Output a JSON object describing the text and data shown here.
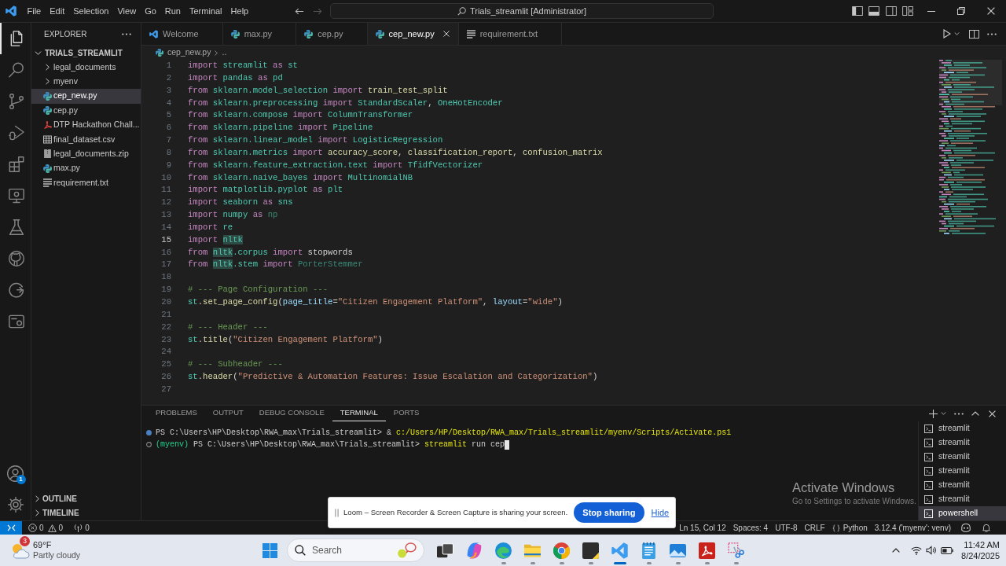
{
  "title_bar": {
    "menu": [
      "File",
      "Edit",
      "Selection",
      "View",
      "Go",
      "Run",
      "Terminal",
      "Help"
    ],
    "navigation": [
      {
        "disabled": false
      },
      {
        "disabled": true
      }
    ],
    "command_center": "Trials_streamlit [Administrator]"
  },
  "activity_bar": {
    "items": [
      {
        "selected": true
      },
      {
        "selected": false
      },
      {
        "selected": false
      },
      {
        "selected": false
      },
      {
        "selected": false
      },
      {
        "selected": false
      },
      {
        "selected": false
      },
      {
        "selected": false
      },
      {
        "selected": false
      },
      {
        "selected": false
      }
    ],
    "accounts_badge": "1"
  },
  "explorer": {
    "title": "EXPLORER",
    "tree": [
      {
        "label": "TRIALS_STREAMLIT",
        "kind": "root",
        "expanded": true,
        "selected": false,
        "children": [
          {
            "label": "legal_documents",
            "kind": "folder",
            "expanded": false,
            "selected": false
          },
          {
            "label": "myenv",
            "kind": "folder",
            "expanded": false,
            "selected": false
          },
          {
            "label": "cep_new.py",
            "kind": "python",
            "selected": true
          },
          {
            "label": "cep.py",
            "kind": "python",
            "selected": false
          },
          {
            "label": "DTP Hackathon Chall...",
            "kind": "pdf",
            "selected": false
          },
          {
            "label": "final_dataset.csv",
            "kind": "csv",
            "selected": false
          },
          {
            "label": "legal_documents.zip",
            "kind": "zip",
            "selected": false
          },
          {
            "label": "max.py",
            "kind": "python",
            "selected": false
          },
          {
            "label": "requirement.txt",
            "kind": "text",
            "selected": false
          }
        ]
      }
    ],
    "sections": [
      {
        "label": "OUTLINE",
        "expanded": false
      },
      {
        "label": "TIMELINE",
        "expanded": false
      }
    ]
  },
  "editor": {
    "tabs": [
      {
        "label": "Welcome",
        "kind": "welcome",
        "selected": false
      },
      {
        "label": "max.py",
        "kind": "python",
        "selected": false
      },
      {
        "label": "cep.py",
        "kind": "python",
        "selected": false
      },
      {
        "label": "cep_new.py",
        "kind": "python",
        "selected": true
      },
      {
        "label": "requirement.txt",
        "kind": "text",
        "selected": false
      }
    ],
    "breadcrumb": [
      "cep_new.py",
      ".."
    ],
    "lines": [
      {
        "number": "1",
        "current": false,
        "tokens": [
          {
            "kind": "keyword",
            "text": "import "
          },
          {
            "kind": "module",
            "text": "streamlit "
          },
          {
            "kind": "keyword",
            "text": "as "
          },
          {
            "kind": "module",
            "text": "st"
          }
        ]
      },
      {
        "number": "2",
        "current": false,
        "tokens": [
          {
            "kind": "keyword",
            "text": "import "
          },
          {
            "kind": "module",
            "text": "pandas "
          },
          {
            "kind": "keyword",
            "text": "as "
          },
          {
            "kind": "module",
            "text": "pd"
          }
        ]
      },
      {
        "number": "3",
        "current": false,
        "tokens": [
          {
            "kind": "keyword",
            "text": "from "
          },
          {
            "kind": "module",
            "text": "sklearn.model_selection "
          },
          {
            "kind": "keyword",
            "text": "import "
          },
          {
            "kind": "function",
            "text": "train_test_split"
          }
        ]
      },
      {
        "number": "4",
        "current": false,
        "tokens": [
          {
            "kind": "keyword",
            "text": "from "
          },
          {
            "kind": "module",
            "text": "sklearn.preprocessing "
          },
          {
            "kind": "keyword",
            "text": "import "
          },
          {
            "kind": "class",
            "text": "StandardScaler"
          },
          {
            "kind": "plain",
            "text": ", "
          },
          {
            "kind": "class",
            "text": "OneHotEncoder"
          }
        ]
      },
      {
        "number": "5",
        "current": false,
        "tokens": [
          {
            "kind": "keyword",
            "text": "from "
          },
          {
            "kind": "module",
            "text": "sklearn.compose "
          },
          {
            "kind": "keyword",
            "text": "import "
          },
          {
            "kind": "class",
            "text": "ColumnTransformer"
          }
        ]
      },
      {
        "number": "6",
        "current": false,
        "tokens": [
          {
            "kind": "keyword",
            "text": "from "
          },
          {
            "kind": "module",
            "text": "sklearn.pipeline "
          },
          {
            "kind": "keyword",
            "text": "import "
          },
          {
            "kind": "class",
            "text": "Pipeline"
          }
        ]
      },
      {
        "number": "7",
        "current": false,
        "tokens": [
          {
            "kind": "keyword",
            "text": "from "
          },
          {
            "kind": "module",
            "text": "sklearn.linear_model "
          },
          {
            "kind": "keyword",
            "text": "import "
          },
          {
            "kind": "class",
            "text": "LogisticRegression"
          }
        ]
      },
      {
        "number": "8",
        "current": false,
        "tokens": [
          {
            "kind": "keyword",
            "text": "from "
          },
          {
            "kind": "module",
            "text": "sklearn.metrics "
          },
          {
            "kind": "keyword",
            "text": "import "
          },
          {
            "kind": "function",
            "text": "accuracy_score"
          },
          {
            "kind": "plain",
            "text": ", "
          },
          {
            "kind": "function",
            "text": "classification_report"
          },
          {
            "kind": "plain",
            "text": ", "
          },
          {
            "kind": "function",
            "text": "confusion_matrix"
          }
        ]
      },
      {
        "number": "9",
        "current": false,
        "tokens": [
          {
            "kind": "keyword",
            "text": "from "
          },
          {
            "kind": "module",
            "text": "sklearn.feature_extraction.text "
          },
          {
            "kind": "keyword",
            "text": "import "
          },
          {
            "kind": "class",
            "text": "TfidfVectorizer"
          }
        ]
      },
      {
        "number": "10",
        "current": false,
        "tokens": [
          {
            "kind": "keyword",
            "text": "from "
          },
          {
            "kind": "module",
            "text": "sklearn.naive_bayes "
          },
          {
            "kind": "keyword",
            "text": "import "
          },
          {
            "kind": "class",
            "text": "MultinomialNB"
          }
        ]
      },
      {
        "number": "11",
        "current": false,
        "tokens": [
          {
            "kind": "keyword",
            "text": "import "
          },
          {
            "kind": "module",
            "text": "matplotlib.pyplot "
          },
          {
            "kind": "keyword",
            "text": "as "
          },
          {
            "kind": "module",
            "text": "plt"
          }
        ]
      },
      {
        "number": "12",
        "current": false,
        "tokens": [
          {
            "kind": "keyword",
            "text": "import "
          },
          {
            "kind": "module",
            "text": "seaborn "
          },
          {
            "kind": "keyword",
            "text": "as "
          },
          {
            "kind": "module",
            "text": "sns"
          }
        ]
      },
      {
        "number": "13",
        "current": false,
        "tokens": [
          {
            "kind": "keyword",
            "text": "import "
          },
          {
            "kind": "module",
            "text": "numpy "
          },
          {
            "kind": "keyword",
            "text": "as "
          },
          {
            "kind": "unused",
            "text": "np"
          }
        ]
      },
      {
        "number": "14",
        "current": false,
        "tokens": [
          {
            "kind": "keyword",
            "text": "import "
          },
          {
            "kind": "module",
            "text": "re"
          }
        ]
      },
      {
        "number": "15",
        "current": true,
        "tokens": [
          {
            "kind": "keyword",
            "text": "import "
          },
          {
            "kind": "match",
            "text": "nltk"
          }
        ]
      },
      {
        "number": "16",
        "current": false,
        "tokens": [
          {
            "kind": "keyword",
            "text": "from "
          },
          {
            "kind": "match",
            "text": "nltk"
          },
          {
            "kind": "module",
            "text": ".corpus "
          },
          {
            "kind": "keyword",
            "text": "import "
          },
          {
            "kind": "name",
            "text": "stopwords"
          }
        ]
      },
      {
        "number": "17",
        "current": false,
        "tokens": [
          {
            "kind": "keyword",
            "text": "from "
          },
          {
            "kind": "match",
            "text": "nltk"
          },
          {
            "kind": "module",
            "text": ".stem "
          },
          {
            "kind": "keyword",
            "text": "import "
          },
          {
            "kind": "unused",
            "text": "PorterStemmer"
          }
        ]
      },
      {
        "number": "18",
        "current": false
      },
      {
        "number": "19",
        "current": false,
        "tokens": [
          {
            "kind": "comment",
            "text": "# --- Page Configuration ---"
          }
        ]
      },
      {
        "number": "20",
        "current": false,
        "tokens": [
          {
            "kind": "module",
            "text": "st"
          },
          {
            "kind": "plain",
            "text": "."
          },
          {
            "kind": "function",
            "text": "set_page_config"
          },
          {
            "kind": "plain",
            "text": "("
          },
          {
            "kind": "variable",
            "text": "page_title"
          },
          {
            "kind": "plain",
            "text": "="
          },
          {
            "kind": "string",
            "text": "\"Citizen Engagement Platform\""
          },
          {
            "kind": "plain",
            "text": ", "
          },
          {
            "kind": "variable",
            "text": "layout"
          },
          {
            "kind": "plain",
            "text": "="
          },
          {
            "kind": "string",
            "text": "\"wide\""
          },
          {
            "kind": "plain",
            "text": ")"
          }
        ]
      },
      {
        "number": "21",
        "current": false
      },
      {
        "number": "22",
        "current": false,
        "tokens": [
          {
            "kind": "comment",
            "text": "# --- Header ---"
          }
        ]
      },
      {
        "number": "23",
        "current": false,
        "tokens": [
          {
            "kind": "module",
            "text": "st"
          },
          {
            "kind": "plain",
            "text": "."
          },
          {
            "kind": "function",
            "text": "title"
          },
          {
            "kind": "plain",
            "text": "("
          },
          {
            "kind": "string",
            "text": "\"Citizen Engagement Platform\""
          },
          {
            "kind": "plain",
            "text": ")"
          }
        ]
      },
      {
        "number": "24",
        "current": false
      },
      {
        "number": "25",
        "current": false,
        "tokens": [
          {
            "kind": "comment",
            "text": "# --- Subheader ---"
          }
        ]
      },
      {
        "number": "26",
        "current": false,
        "tokens": [
          {
            "kind": "module",
            "text": "st"
          },
          {
            "kind": "plain",
            "text": "."
          },
          {
            "kind": "function",
            "text": "header"
          },
          {
            "kind": "plain",
            "text": "("
          },
          {
            "kind": "string",
            "text": "\"Predictive & Automation Features: Issue Escalation and Categorization\""
          },
          {
            "kind": "plain",
            "text": ")"
          }
        ]
      },
      {
        "number": "27",
        "current": false
      }
    ]
  },
  "panel": {
    "tabs": [
      {
        "label": "PROBLEMS",
        "selected": false
      },
      {
        "label": "OUTPUT",
        "selected": false
      },
      {
        "label": "DEBUG CONSOLE",
        "selected": false
      },
      {
        "label": "TERMINAL",
        "selected": true
      },
      {
        "label": "PORTS",
        "selected": false
      }
    ],
    "terminal_lines": [
      {
        "finished": true,
        "cursor": false,
        "tokens": [
          {
            "kind": "prompt",
            "text": "PS C:\\Users\\HP\\Desktop\\RWA_max\\Trials_streamlit> "
          },
          {
            "kind": "operator",
            "text": "& "
          },
          {
            "kind": "command",
            "text": "c:/Users/HP/Desktop/RWA_max/Trials_streamlit/myenv/Scripts/Activate.ps1"
          }
        ]
      },
      {
        "finished": false,
        "cursor": true,
        "tokens": [
          {
            "kind": "env",
            "text": "(myenv) "
          },
          {
            "kind": "prompt",
            "text": "PS C:\\Users\\HP\\Desktop\\RWA_max\\Trials_streamlit> "
          },
          {
            "kind": "command",
            "text": "streamlit"
          },
          {
            "kind": "argument",
            "text": " run cep"
          }
        ]
      }
    ],
    "terminals": [
      {
        "label": "streamlit",
        "selected": false
      },
      {
        "label": "streamlit",
        "selected": false
      },
      {
        "label": "streamlit",
        "selected": false
      },
      {
        "label": "streamlit",
        "selected": false
      },
      {
        "label": "streamlit",
        "selected": false
      },
      {
        "label": "streamlit",
        "selected": false
      },
      {
        "label": "powershell",
        "selected": true
      }
    ]
  },
  "status_bar": {
    "errors": "0",
    "warnings": "0",
    "ports": "0",
    "items": [
      {
        "kind": "text",
        "label": "Ln 15, Col 12"
      },
      {
        "kind": "text",
        "label": "Spaces: 4"
      },
      {
        "kind": "text",
        "label": "UTF-8"
      },
      {
        "kind": "text",
        "label": "CRLF"
      },
      {
        "kind": "language",
        "label": "Python"
      },
      {
        "kind": "text",
        "label": "3.12.4 ('myenv': venv)"
      }
    ]
  },
  "notification": {
    "message": "Loom – Screen Recorder & Screen Capture is sharing your screen.",
    "button": "Stop sharing",
    "link": "Hide"
  },
  "activation_notice": {
    "title": "Activate Windows",
    "message": "Go to Settings to activate Windows."
  },
  "taskbar": {
    "weather": {
      "badge": "3",
      "temperature": "69°F",
      "condition": "Partly cloudy"
    },
    "search": {
      "placeholder": "Search"
    },
    "apps": [
      {
        "running": false,
        "selected": false
      },
      {
        "running": false,
        "selected": false
      },
      {
        "running": true,
        "selected": false
      },
      {
        "running": true,
        "selected": false
      },
      {
        "running": true,
        "selected": false
      },
      {
        "running": true,
        "selected": false
      },
      {
        "running": true,
        "selected": true
      },
      {
        "running": true,
        "selected": false
      },
      {
        "running": true,
        "selected": false
      },
      {
        "running": true,
        "selected": false
      },
      {
        "running": true,
        "selected": false
      }
    ],
    "clock": {
      "time": "11:42 AM",
      "date": "8/24/2025"
    }
  }
}
